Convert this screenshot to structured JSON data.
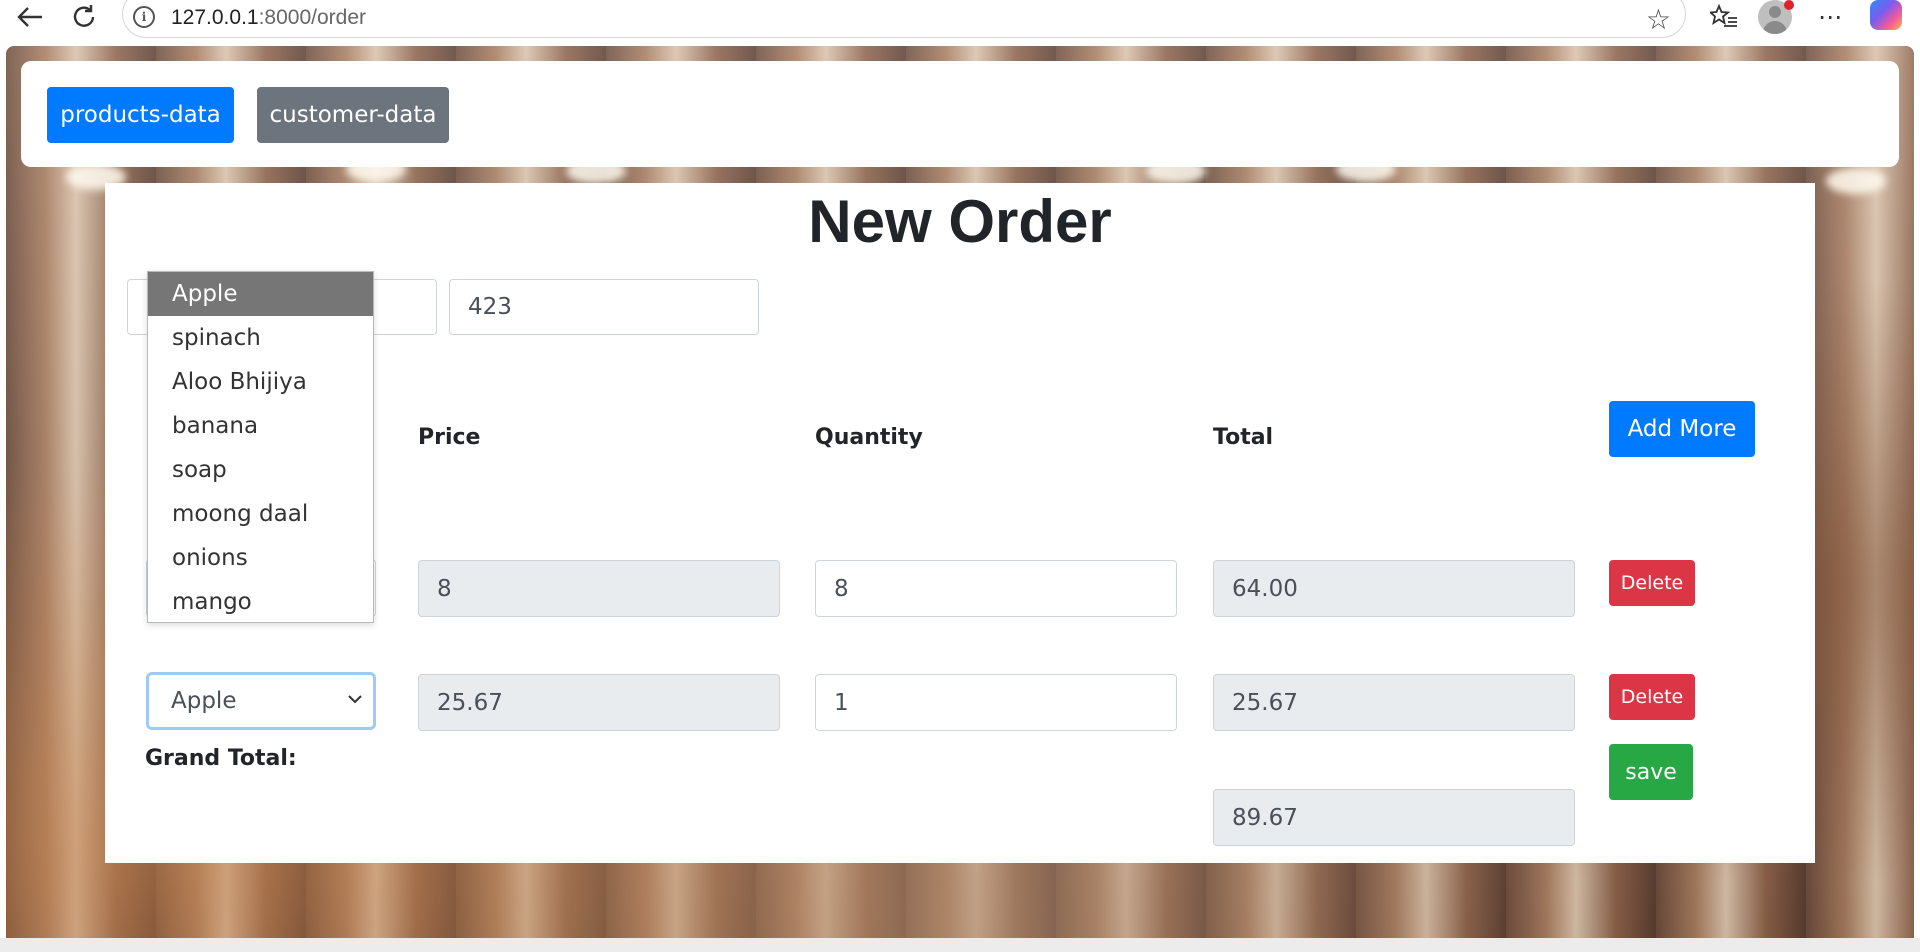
{
  "browser": {
    "url_host": "127.0.0.1",
    "url_rest": ":8000/order",
    "icons": [
      "back-arrow-icon",
      "reload-icon",
      "info-icon",
      "star-icon",
      "favorites-icon",
      "avatar-icon",
      "more-icon",
      "copilot-icon"
    ]
  },
  "navbar": {
    "products_label": "products-data",
    "customers_label": "customer-data"
  },
  "order": {
    "title": "New Order",
    "customer_name": "",
    "customer_phone": "423",
    "headers": {
      "price": "Price",
      "quantity": "Quantity",
      "total": "Total"
    },
    "add_more_label": "Add More",
    "rows": [
      {
        "product": "",
        "price": "8",
        "quantity": "8",
        "total": "64.00",
        "delete_label": "Delete"
      },
      {
        "product": "Apple",
        "price": "25.67",
        "quantity": "1",
        "total": "25.67",
        "delete_label": "Delete"
      }
    ],
    "grand_total_label": "Grand Total:",
    "grand_total": "89.67",
    "save_label": "save"
  },
  "dropdown": {
    "options": [
      "Apple",
      "spinach",
      "Aloo Bhijiya",
      "banana",
      "soap",
      "moong daal",
      "onions",
      "mango"
    ],
    "selected": "Apple"
  },
  "colors": {
    "primary": "#007bff",
    "secondary": "#6c757d",
    "danger": "#dc3545",
    "success": "#28a745",
    "readonly_bg": "#e9ecef",
    "dropdown_selected": "#767676"
  }
}
